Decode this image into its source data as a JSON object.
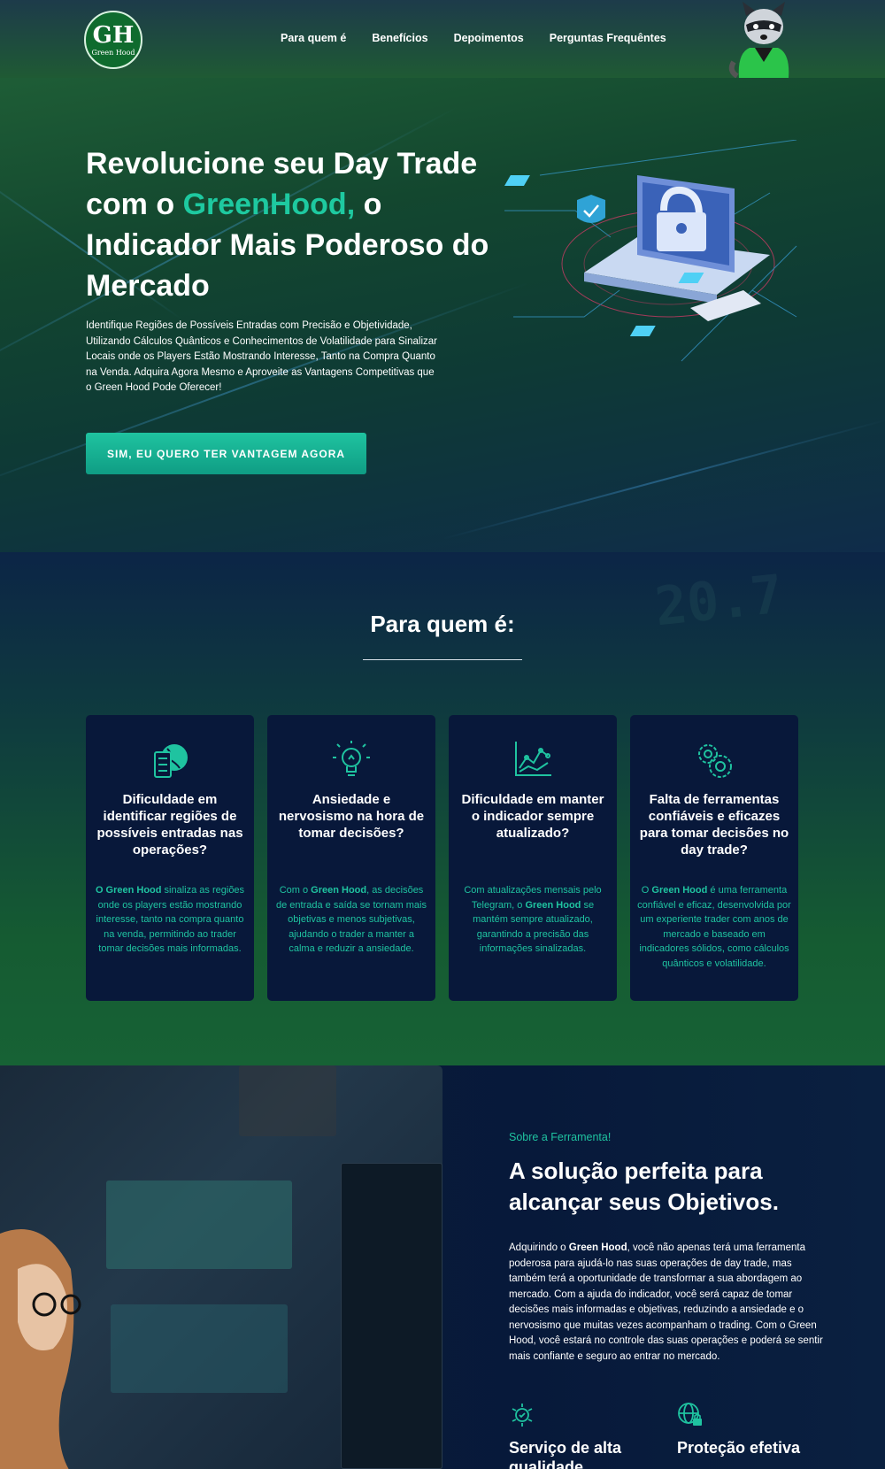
{
  "brand": {
    "logo_text": "Green Hood",
    "logo_mark": "GH"
  },
  "nav": {
    "items": [
      "Para quem é",
      "Benefícios",
      "Depoimentos",
      "Perguntas Frequêntes"
    ]
  },
  "hero": {
    "title_part1": "Revolucione seu Day Trade com o ",
    "title_highlight": "GreenHood,",
    "title_part2": " o Indicador Mais Poderoso do Mercado",
    "subtitle": "Identifique Regiões de Possíveis Entradas com Precisão e Objetividade, Utilizando Cálculos Quânticos e Conhecimentos de Volatilidade para Sinalizar Locais onde os Players Estão Mostrando Interesse, Tanto na Compra Quanto na Venda. Adquira Agora Mesmo e Aproveite as Vantagens Competitivas que o Green Hood Pode Oferecer!",
    "cta_label": "SIM, EU QUERO TER VANTAGEM AGORA"
  },
  "para_quem": {
    "title": "Para quem é:",
    "cards": [
      {
        "icon": "globe-server-icon",
        "title": "Dificuldade em identificar regiões de possíveis entradas nas operações?",
        "text_strong": "O Green Hood",
        "text_rest": " sinaliza as regiões onde os players estão mostrando interesse, tanto na compra quanto na venda, permitindo ao trader tomar decisões mais informadas."
      },
      {
        "icon": "lightbulb-icon",
        "title": "Ansiedade e nervosismo na hora de tomar decisões?",
        "text_pre": "Com o ",
        "text_strong": "Green Hood",
        "text_rest": ", as decisões de entrada e saída se tornam mais objetivas e menos subjetivas, ajudando o trader a manter a calma e reduzir a ansiedade."
      },
      {
        "icon": "line-chart-icon",
        "title": "Dificuldade em manter o indicador sempre atualizado?",
        "text_pre": "Com atualizações mensais pelo Telegram, o ",
        "text_strong": "Green Hood",
        "text_rest": " se mantém sempre atualizado, garantindo a precisão das informações sinalizadas."
      },
      {
        "icon": "gears-icon",
        "title": "Falta de ferramentas confiáveis e eficazes para tomar decisões no day trade?",
        "text_pre": "O ",
        "text_strong": "Green Hood",
        "text_rest": " é uma ferramenta confiável e eficaz, desenvolvida por um experiente trader com anos de mercado e baseado em indicadores sólidos, como cálculos quânticos e volatilidade."
      }
    ]
  },
  "sobre": {
    "kicker": "Sobre a Ferramenta!",
    "title": "A solução perfeita para alcançar seus Objetivos.",
    "body_pre": "Adquirindo o ",
    "body_strong": "Green Hood",
    "body_rest": ", você não apenas terá uma ferramenta poderosa para ajudá-lo nas suas operações de day trade, mas também terá a oportunidade de transformar a sua abordagem ao mercado. Com a ajuda do indicador, você será capaz de tomar decisões mais informadas e objetivas, reduzindo a ansiedade e o nervosismo que muitas vezes acompanham o trading. Com o Green Hood, você estará no controle das suas operações e poderá se sentir mais confiante e seguro ao entrar no mercado.",
    "features": [
      {
        "icon": "quality-icon",
        "title": "Serviço de alta qualidade"
      },
      {
        "icon": "protection-globe-icon",
        "title": "Proteção efetiva"
      }
    ]
  },
  "colors": {
    "accent": "#1fc3a0",
    "card_bg": "#08183a",
    "header_green": "#1f5a34"
  }
}
